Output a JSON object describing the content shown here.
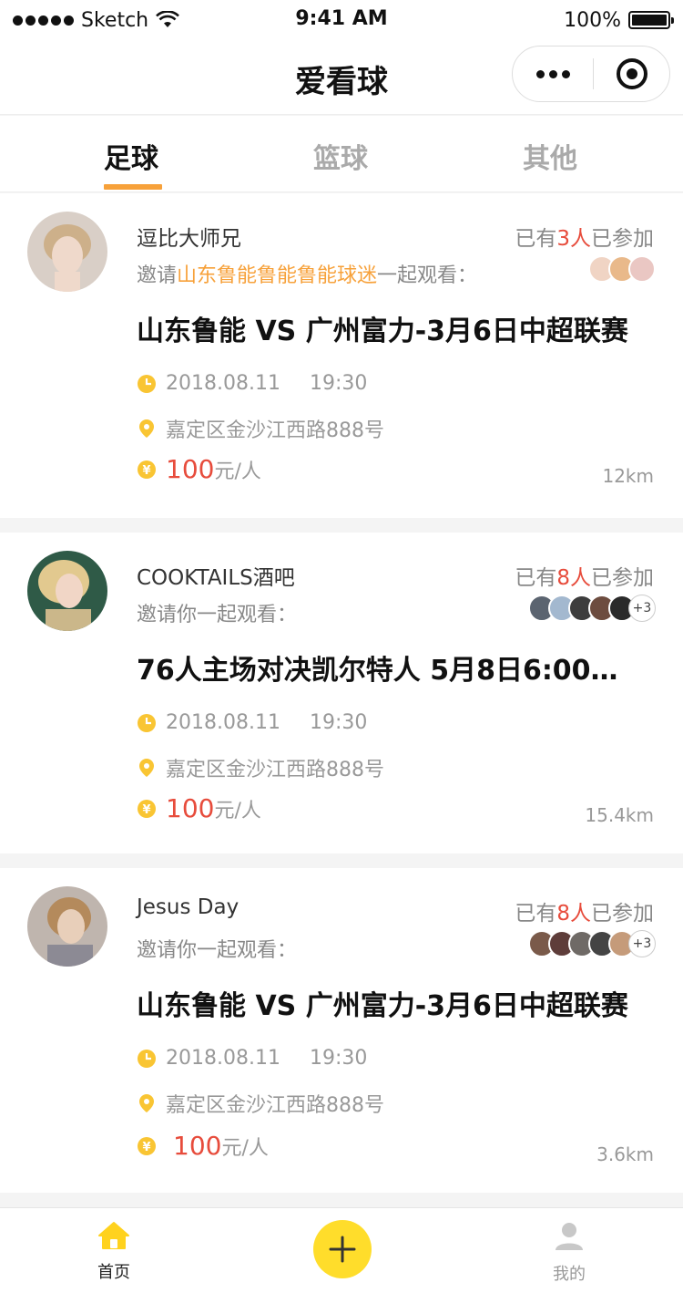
{
  "status_bar": {
    "carrier": "Sketch",
    "time": "9:41 AM",
    "battery": "100%"
  },
  "nav": {
    "title": "爱看球"
  },
  "tabs": [
    {
      "label": "足球",
      "active": true
    },
    {
      "label": "篮球",
      "active": false
    },
    {
      "label": "其他",
      "active": false
    }
  ],
  "cards": [
    {
      "host": "逗比大师兄",
      "joined_prefix": "已有",
      "joined_count": "3人",
      "joined_suffix": "已参加",
      "invite_prefix": "邀请",
      "invite_target": "山东鲁能鲁能鲁能球迷",
      "invite_suffix": "一起观看：",
      "participants_more": "",
      "title": "山东鲁能 VS 广州富力-3月6日中超联赛",
      "date": "2018.08.11",
      "time": "19:30",
      "address": "嘉定区金沙江西路888号",
      "price": "100",
      "price_unit": "元/人",
      "distance": "12km"
    },
    {
      "host": "COOKTAILS酒吧",
      "joined_prefix": "已有",
      "joined_count": "8人",
      "joined_suffix": "已参加",
      "invite_prefix": "邀请你一起观看：",
      "invite_target": "",
      "invite_suffix": "",
      "participants_more": "+3",
      "title": "76人主场对决凯尔特人 5月8日6:00…",
      "date": "2018.08.11",
      "time": "19:30",
      "address": "嘉定区金沙江西路888号",
      "price": "100",
      "price_unit": "元/人",
      "distance": "15.4km"
    },
    {
      "host": "Jesus Day",
      "joined_prefix": "已有",
      "joined_count": "8人",
      "joined_suffix": "已参加",
      "invite_prefix": "邀请你一起观看：",
      "invite_target": "",
      "invite_suffix": "",
      "participants_more": "+3",
      "title": "山东鲁能 VS 广州富力-3月6日中超联赛",
      "date": "2018.08.11",
      "time": "19:30",
      "address": "嘉定区金沙江西路888号",
      "price": "100",
      "price_unit": "元/人",
      "distance": "3.6km"
    }
  ],
  "tabbar": {
    "home": "首页",
    "mine": "我的"
  },
  "colors": {
    "accent": "#f7a13a",
    "highlight_red": "#e74c3c",
    "plus_yellow": "#ffdd2b"
  }
}
